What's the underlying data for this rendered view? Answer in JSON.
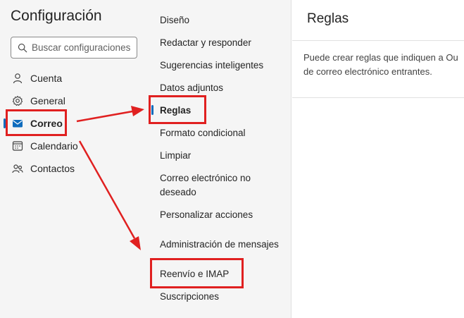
{
  "settings": {
    "title": "Configuración",
    "search_placeholder": "Buscar configuraciones"
  },
  "categories": [
    {
      "label": "Cuenta",
      "icon": "person-icon"
    },
    {
      "label": "General",
      "icon": "gear-icon"
    },
    {
      "label": "Correo",
      "icon": "mail-icon",
      "selected": true
    },
    {
      "label": "Calendario",
      "icon": "calendar-icon"
    },
    {
      "label": "Contactos",
      "icon": "people-icon"
    }
  ],
  "mail_menu": [
    {
      "label": "Diseño"
    },
    {
      "label": "Redactar y responder"
    },
    {
      "label": "Sugerencias inteligentes"
    },
    {
      "label": "Datos adjuntos"
    },
    {
      "label": "Reglas",
      "selected": true
    },
    {
      "label": "Formato condicional"
    },
    {
      "label": "Limpiar"
    },
    {
      "label": "Correo electrónico no deseado"
    },
    {
      "label": "Personalizar acciones"
    },
    {
      "label": "Administración de mensajes"
    },
    {
      "label": "Reenvío e IMAP"
    },
    {
      "label": "Suscripciones"
    }
  ],
  "pane": {
    "title": "Reglas",
    "description_line1": "Puede crear reglas que indiquen a Ou",
    "description_line2": "de correo electrónico entrantes."
  },
  "colors": {
    "accent": "#0f6cbd",
    "annotation": "#e02020"
  }
}
